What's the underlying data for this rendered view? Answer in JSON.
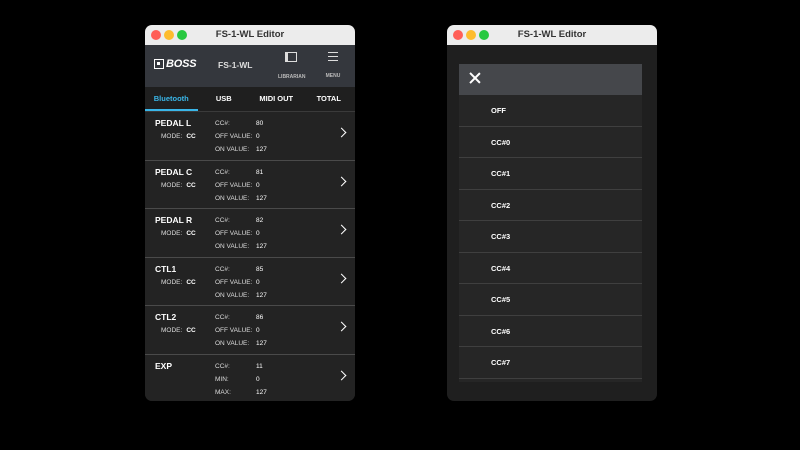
{
  "window_title": "FS-1-WL Editor",
  "header": {
    "logo": "BOSS",
    "model": "FS-1-WL",
    "librarian_label": "LIBRARIAN",
    "menu_label": "MENU"
  },
  "tabs": [
    {
      "label": "Bluetooth",
      "active": true
    },
    {
      "label": "USB"
    },
    {
      "label": "MIDI OUT"
    },
    {
      "label": "TOTAL"
    }
  ],
  "pedals": [
    {
      "name": "PEDAL L",
      "mode_label": "MODE:",
      "mode": "CC",
      "params": [
        {
          "k": "CC#:",
          "v": "80"
        },
        {
          "k": "OFF VALUE:",
          "v": "0"
        },
        {
          "k": "ON VALUE:",
          "v": "127"
        }
      ]
    },
    {
      "name": "PEDAL C",
      "mode_label": "MODE:",
      "mode": "CC",
      "params": [
        {
          "k": "CC#:",
          "v": "81"
        },
        {
          "k": "OFF VALUE:",
          "v": "0"
        },
        {
          "k": "ON VALUE:",
          "v": "127"
        }
      ]
    },
    {
      "name": "PEDAL R",
      "mode_label": "MODE:",
      "mode": "CC",
      "params": [
        {
          "k": "CC#:",
          "v": "82"
        },
        {
          "k": "OFF VALUE:",
          "v": "0"
        },
        {
          "k": "ON VALUE:",
          "v": "127"
        }
      ]
    },
    {
      "name": "CTL1",
      "mode_label": "MODE:",
      "mode": "CC",
      "params": [
        {
          "k": "CC#:",
          "v": "85"
        },
        {
          "k": "OFF VALUE:",
          "v": "0"
        },
        {
          "k": "ON VALUE:",
          "v": "127"
        }
      ]
    },
    {
      "name": "CTL2",
      "mode_label": "MODE:",
      "mode": "CC",
      "params": [
        {
          "k": "CC#:",
          "v": "86"
        },
        {
          "k": "OFF VALUE:",
          "v": "0"
        },
        {
          "k": "ON VALUE:",
          "v": "127"
        }
      ]
    },
    {
      "name": "EXP",
      "params": [
        {
          "k": "CC#:",
          "v": "11"
        },
        {
          "k": "MIN:",
          "v": "0"
        },
        {
          "k": "MAX:",
          "v": "127"
        }
      ]
    }
  ],
  "options": [
    "OFF",
    "CC#0",
    "CC#1",
    "CC#2",
    "CC#3",
    "CC#4",
    "CC#5",
    "CC#6",
    "CC#7"
  ],
  "colors": {
    "accent": "#3ab6e8",
    "header_bg": "#34373d",
    "modal_header": "#45474b"
  }
}
